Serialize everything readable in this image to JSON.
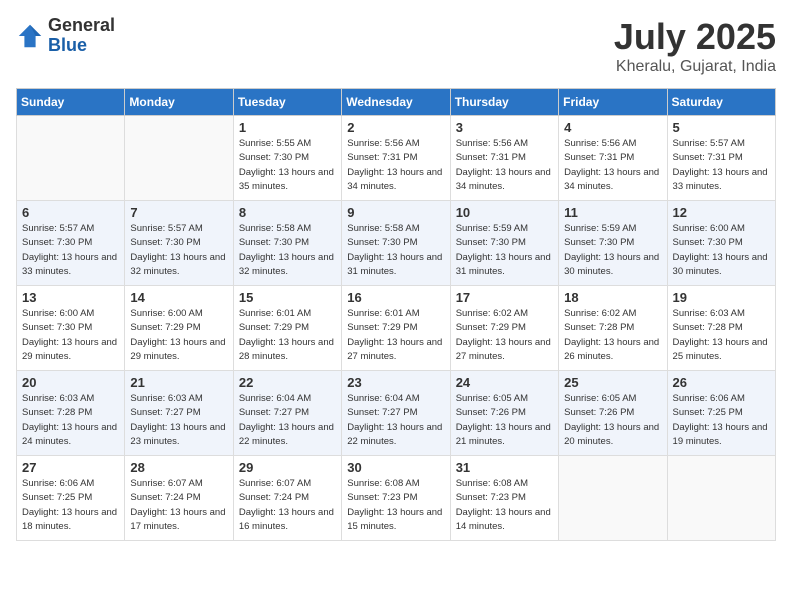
{
  "header": {
    "logo_general": "General",
    "logo_blue": "Blue",
    "month_year": "July 2025",
    "location": "Kheralu, Gujarat, India"
  },
  "days_of_week": [
    "Sunday",
    "Monday",
    "Tuesday",
    "Wednesday",
    "Thursday",
    "Friday",
    "Saturday"
  ],
  "weeks": [
    [
      {
        "day": "",
        "empty": true
      },
      {
        "day": "",
        "empty": true
      },
      {
        "day": "1",
        "sunrise": "Sunrise: 5:55 AM",
        "sunset": "Sunset: 7:30 PM",
        "daylight": "Daylight: 13 hours and 35 minutes."
      },
      {
        "day": "2",
        "sunrise": "Sunrise: 5:56 AM",
        "sunset": "Sunset: 7:31 PM",
        "daylight": "Daylight: 13 hours and 34 minutes."
      },
      {
        "day": "3",
        "sunrise": "Sunrise: 5:56 AM",
        "sunset": "Sunset: 7:31 PM",
        "daylight": "Daylight: 13 hours and 34 minutes."
      },
      {
        "day": "4",
        "sunrise": "Sunrise: 5:56 AM",
        "sunset": "Sunset: 7:31 PM",
        "daylight": "Daylight: 13 hours and 34 minutes."
      },
      {
        "day": "5",
        "sunrise": "Sunrise: 5:57 AM",
        "sunset": "Sunset: 7:31 PM",
        "daylight": "Daylight: 13 hours and 33 minutes."
      }
    ],
    [
      {
        "day": "6",
        "sunrise": "Sunrise: 5:57 AM",
        "sunset": "Sunset: 7:30 PM",
        "daylight": "Daylight: 13 hours and 33 minutes."
      },
      {
        "day": "7",
        "sunrise": "Sunrise: 5:57 AM",
        "sunset": "Sunset: 7:30 PM",
        "daylight": "Daylight: 13 hours and 32 minutes."
      },
      {
        "day": "8",
        "sunrise": "Sunrise: 5:58 AM",
        "sunset": "Sunset: 7:30 PM",
        "daylight": "Daylight: 13 hours and 32 minutes."
      },
      {
        "day": "9",
        "sunrise": "Sunrise: 5:58 AM",
        "sunset": "Sunset: 7:30 PM",
        "daylight": "Daylight: 13 hours and 31 minutes."
      },
      {
        "day": "10",
        "sunrise": "Sunrise: 5:59 AM",
        "sunset": "Sunset: 7:30 PM",
        "daylight": "Daylight: 13 hours and 31 minutes."
      },
      {
        "day": "11",
        "sunrise": "Sunrise: 5:59 AM",
        "sunset": "Sunset: 7:30 PM",
        "daylight": "Daylight: 13 hours and 30 minutes."
      },
      {
        "day": "12",
        "sunrise": "Sunrise: 6:00 AM",
        "sunset": "Sunset: 7:30 PM",
        "daylight": "Daylight: 13 hours and 30 minutes."
      }
    ],
    [
      {
        "day": "13",
        "sunrise": "Sunrise: 6:00 AM",
        "sunset": "Sunset: 7:30 PM",
        "daylight": "Daylight: 13 hours and 29 minutes."
      },
      {
        "day": "14",
        "sunrise": "Sunrise: 6:00 AM",
        "sunset": "Sunset: 7:29 PM",
        "daylight": "Daylight: 13 hours and 29 minutes."
      },
      {
        "day": "15",
        "sunrise": "Sunrise: 6:01 AM",
        "sunset": "Sunset: 7:29 PM",
        "daylight": "Daylight: 13 hours and 28 minutes."
      },
      {
        "day": "16",
        "sunrise": "Sunrise: 6:01 AM",
        "sunset": "Sunset: 7:29 PM",
        "daylight": "Daylight: 13 hours and 27 minutes."
      },
      {
        "day": "17",
        "sunrise": "Sunrise: 6:02 AM",
        "sunset": "Sunset: 7:29 PM",
        "daylight": "Daylight: 13 hours and 27 minutes."
      },
      {
        "day": "18",
        "sunrise": "Sunrise: 6:02 AM",
        "sunset": "Sunset: 7:28 PM",
        "daylight": "Daylight: 13 hours and 26 minutes."
      },
      {
        "day": "19",
        "sunrise": "Sunrise: 6:03 AM",
        "sunset": "Sunset: 7:28 PM",
        "daylight": "Daylight: 13 hours and 25 minutes."
      }
    ],
    [
      {
        "day": "20",
        "sunrise": "Sunrise: 6:03 AM",
        "sunset": "Sunset: 7:28 PM",
        "daylight": "Daylight: 13 hours and 24 minutes."
      },
      {
        "day": "21",
        "sunrise": "Sunrise: 6:03 AM",
        "sunset": "Sunset: 7:27 PM",
        "daylight": "Daylight: 13 hours and 23 minutes."
      },
      {
        "day": "22",
        "sunrise": "Sunrise: 6:04 AM",
        "sunset": "Sunset: 7:27 PM",
        "daylight": "Daylight: 13 hours and 22 minutes."
      },
      {
        "day": "23",
        "sunrise": "Sunrise: 6:04 AM",
        "sunset": "Sunset: 7:27 PM",
        "daylight": "Daylight: 13 hours and 22 minutes."
      },
      {
        "day": "24",
        "sunrise": "Sunrise: 6:05 AM",
        "sunset": "Sunset: 7:26 PM",
        "daylight": "Daylight: 13 hours and 21 minutes."
      },
      {
        "day": "25",
        "sunrise": "Sunrise: 6:05 AM",
        "sunset": "Sunset: 7:26 PM",
        "daylight": "Daylight: 13 hours and 20 minutes."
      },
      {
        "day": "26",
        "sunrise": "Sunrise: 6:06 AM",
        "sunset": "Sunset: 7:25 PM",
        "daylight": "Daylight: 13 hours and 19 minutes."
      }
    ],
    [
      {
        "day": "27",
        "sunrise": "Sunrise: 6:06 AM",
        "sunset": "Sunset: 7:25 PM",
        "daylight": "Daylight: 13 hours and 18 minutes."
      },
      {
        "day": "28",
        "sunrise": "Sunrise: 6:07 AM",
        "sunset": "Sunset: 7:24 PM",
        "daylight": "Daylight: 13 hours and 17 minutes."
      },
      {
        "day": "29",
        "sunrise": "Sunrise: 6:07 AM",
        "sunset": "Sunset: 7:24 PM",
        "daylight": "Daylight: 13 hours and 16 minutes."
      },
      {
        "day": "30",
        "sunrise": "Sunrise: 6:08 AM",
        "sunset": "Sunset: 7:23 PM",
        "daylight": "Daylight: 13 hours and 15 minutes."
      },
      {
        "day": "31",
        "sunrise": "Sunrise: 6:08 AM",
        "sunset": "Sunset: 7:23 PM",
        "daylight": "Daylight: 13 hours and 14 minutes."
      },
      {
        "day": "",
        "empty": true
      },
      {
        "day": "",
        "empty": true
      }
    ]
  ]
}
